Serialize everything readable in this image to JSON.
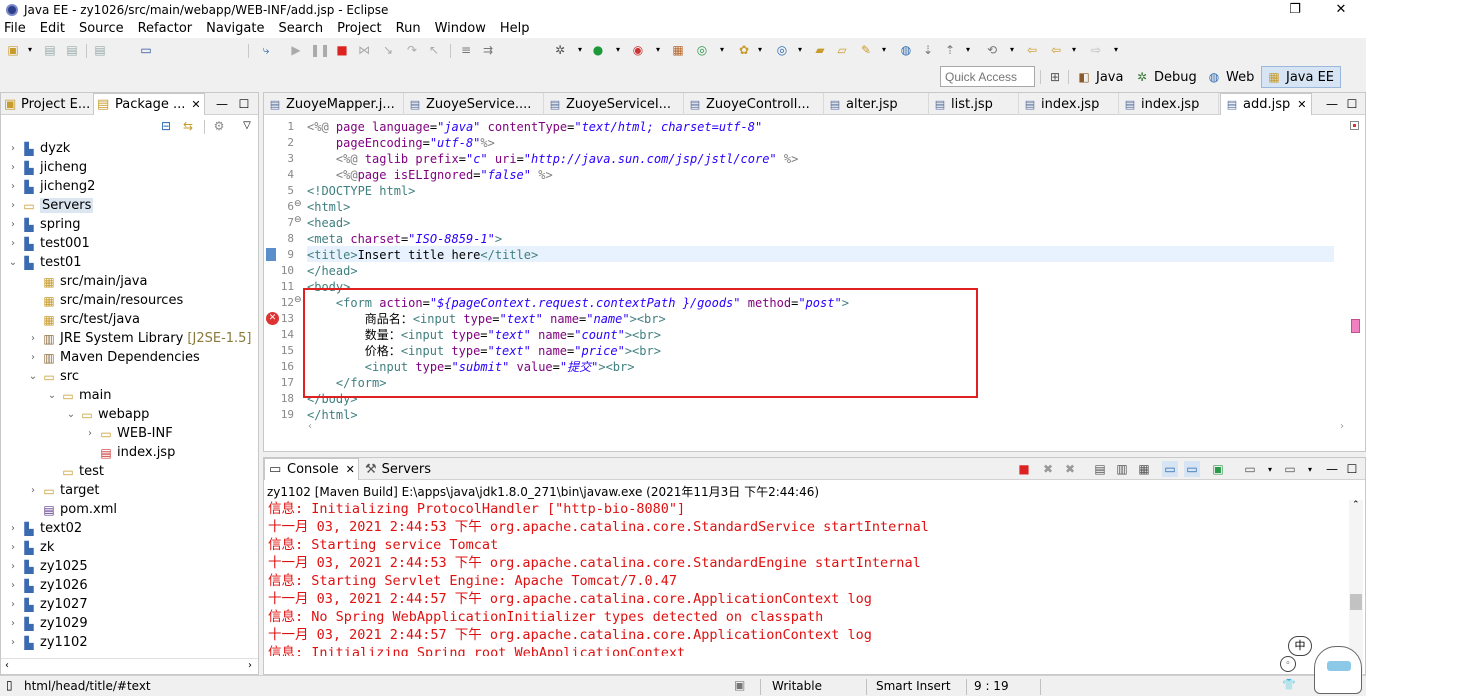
{
  "window": {
    "title": "Java EE - zy1026/src/main/webapp/WEB-INF/add.jsp - Eclipse",
    "restore_glyph": "❐",
    "close_glyph": "✕"
  },
  "menu": [
    "File",
    "Edit",
    "Source",
    "Refactor",
    "Navigate",
    "Search",
    "Project",
    "Run",
    "Window",
    "Help"
  ],
  "quick_access": {
    "placeholder": "Quick Access"
  },
  "perspectives": [
    "Java",
    "Debug",
    "Web",
    "Java EE"
  ],
  "left_panel": {
    "tabs": [
      "Project E...",
      "Package ..."
    ],
    "tree": [
      {
        "label": "dyzk",
        "decoration": ""
      },
      {
        "label": "jicheng",
        "decoration": ""
      },
      {
        "label": "jicheng2",
        "decoration": ""
      },
      {
        "label": "Servers",
        "decoration": ""
      },
      {
        "label": "spring",
        "decoration": ""
      },
      {
        "label": "test001",
        "decoration": ""
      },
      {
        "label": "test01",
        "decoration": ""
      },
      {
        "label": "src/main/java",
        "decoration": ""
      },
      {
        "label": "src/main/resources",
        "decoration": ""
      },
      {
        "label": "src/test/java",
        "decoration": ""
      },
      {
        "label": "JRE System Library",
        "decoration": "[J2SE-1.5]"
      },
      {
        "label": "Maven Dependencies",
        "decoration": ""
      },
      {
        "label": "src",
        "decoration": ""
      },
      {
        "label": "main",
        "decoration": ""
      },
      {
        "label": "webapp",
        "decoration": ""
      },
      {
        "label": "WEB-INF",
        "decoration": ""
      },
      {
        "label": "index.jsp",
        "decoration": ""
      },
      {
        "label": "test",
        "decoration": ""
      },
      {
        "label": "target",
        "decoration": ""
      },
      {
        "label": "pom.xml",
        "decoration": ""
      },
      {
        "label": "text02",
        "decoration": ""
      },
      {
        "label": "zk",
        "decoration": ""
      },
      {
        "label": "zy1025",
        "decoration": ""
      },
      {
        "label": "zy1026",
        "decoration": ""
      },
      {
        "label": "zy1027",
        "decoration": ""
      },
      {
        "label": "zy1029",
        "decoration": ""
      },
      {
        "label": "zy1102",
        "decoration": ""
      }
    ]
  },
  "editor": {
    "tabs": [
      "ZuoyeMapper.j...",
      "ZuoyeService....",
      "ZuoyeServiceI...",
      "ZuoyeControll...",
      "alter.jsp",
      "list.jsp",
      "index.jsp",
      "index.jsp",
      "add.jsp"
    ],
    "line_numbers": [
      "1",
      "2",
      "3",
      "4",
      "5",
      "6",
      "7",
      "8",
      "9",
      "10",
      "11",
      "12",
      "13",
      "14",
      "15",
      "16",
      "17",
      "18",
      "19"
    ],
    "code": {
      "l1": {
        "p1": "<%@ ",
        "k1": "page ",
        "a1": "language",
        "e1": "=",
        "v1": "\"java\"",
        "a2": " contentType",
        "e2": "=",
        "v2": "\"text/html; charset=utf-8\""
      },
      "l2": {
        "a1": "    pageEncoding",
        "e1": "=",
        "v1": "\"utf-8\"",
        "p1": "%>"
      },
      "l3": {
        "p1": "    <%@ ",
        "k1": "taglib ",
        "a1": "prefix",
        "e1": "=",
        "v1": "\"c\"",
        "a2": " uri",
        "e2": "=",
        "v2": "\"http://java.sun.com/jsp/jstl/core\"",
        "p2": " %>"
      },
      "l4": {
        "p1": "    <%@",
        "k1": "page ",
        "a1": "isELIgnored",
        "e1": "=",
        "v1": "\"false\"",
        "p2": " %>"
      },
      "l5": {
        "t1": "<!DOCTYPE ",
        "k1": "html",
        "t2": ">"
      },
      "l6": {
        "t1": "<html>"
      },
      "l7": {
        "t1": "<head>"
      },
      "l8": {
        "t1": "<meta ",
        "a1": "charset",
        "e1": "=",
        "v1": "\"ISO-8859-1\"",
        "t2": ">"
      },
      "l9": {
        "t1": "<title>",
        "p1": "Insert title here",
        "t2": "</title>"
      },
      "l10": {
        "t1": "</head>"
      },
      "l11": {
        "t1": "<body>"
      },
      "l12": {
        "t1": "    <form ",
        "a1": "action",
        "e1": "=",
        "v1": "\"${pageContext.request.contextPath }/goods\"",
        "a2": " method",
        "e2": "=",
        "v2": "\"post\"",
        "t2": ">"
      },
      "l13": {
        "p1": "        商品名：",
        "t1": "<input ",
        "a1": "type",
        "e1": "=",
        "v1": "\"text\"",
        "a2": " name",
        "e2": "=",
        "v2": "\"name\"",
        "t2": "><br>"
      },
      "l14": {
        "p1": "        数量：",
        "t1": "<input ",
        "a1": "type",
        "e1": "=",
        "v1": "\"text\"",
        "a2": " name",
        "e2": "=",
        "v2": "\"count\"",
        "t2": "><br>"
      },
      "l15": {
        "p1": "        价格：",
        "t1": "<input ",
        "a1": "type",
        "e1": "=",
        "v1": "\"text\"",
        "a2": " name",
        "e2": "=",
        "v2": "\"price\"",
        "t2": "><br>"
      },
      "l16": {
        "t1": "        <input ",
        "a1": "type",
        "e1": "=",
        "v1": "\"submit\"",
        "a2": " value",
        "e2": "=",
        "v2": "\"提交\"",
        "t2": "><br>"
      },
      "l17": {
        "t1": "    </form>"
      },
      "l18": {
        "t1": "</body>"
      },
      "l19": {
        "t1": "</html>"
      }
    }
  },
  "console": {
    "tabs": [
      "Console",
      "Servers"
    ],
    "description": "zy1102 [Maven Build] E:\\apps\\java\\jdk1.8.0_271\\bin\\javaw.exe (2021年11月3日 下午2:44:46)",
    "lines": [
      "信息: Initializing ProtocolHandler [\"http-bio-8080\"]",
      "十一月 03, 2021 2:44:53 下午 org.apache.catalina.core.StandardService startInternal",
      "信息: Starting service Tomcat",
      "十一月 03, 2021 2:44:53 下午 org.apache.catalina.core.StandardEngine startInternal",
      "信息: Starting Servlet Engine: Apache Tomcat/7.0.47",
      "十一月 03, 2021 2:44:57 下午 org.apache.catalina.core.ApplicationContext log",
      "信息: No Spring WebApplicationInitializer types detected on classpath",
      "十一月 03, 2021 2:44:57 下午 org.apache.catalina.core.ApplicationContext log",
      "信息: Initializing Spring root WebApplicationContext"
    ]
  },
  "status": {
    "path": "html/head/title/#text",
    "writable": "Writable",
    "insert_mode": "Smart Insert",
    "position": "9 : 19"
  },
  "ime": {
    "label": "中"
  }
}
